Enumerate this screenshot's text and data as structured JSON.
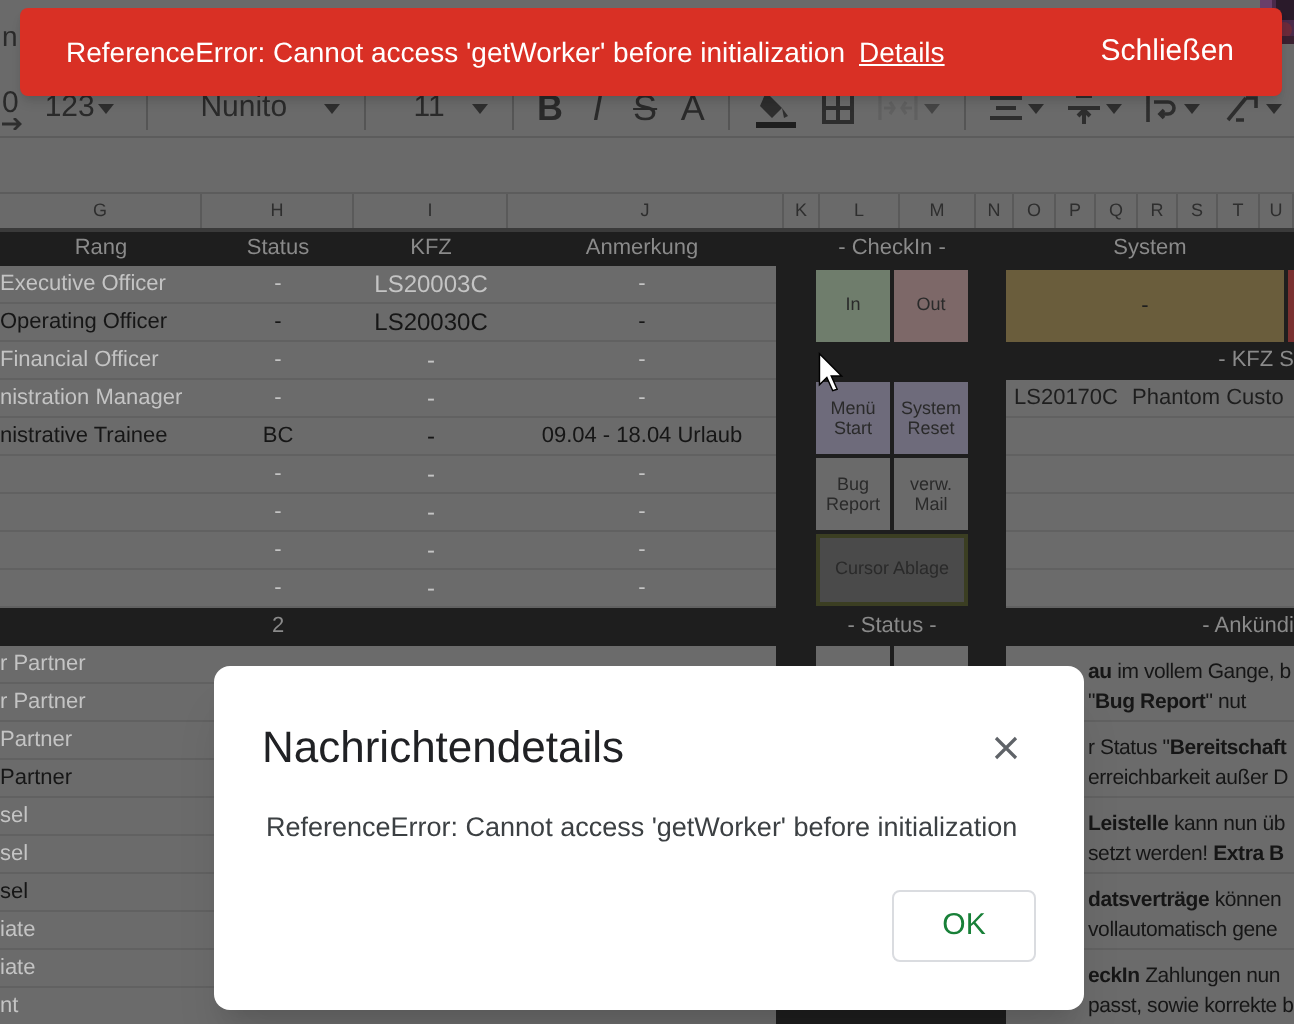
{
  "menu_fragment": "n",
  "toolbar": [
    {
      "kind": "decimal",
      "label": "0"
    },
    {
      "kind": "dropdown",
      "label": "123"
    },
    {
      "kind": "divider"
    },
    {
      "kind": "font_select",
      "label": "Nunito"
    },
    {
      "kind": "divider"
    },
    {
      "kind": "size_select",
      "label": "11"
    },
    {
      "kind": "divider"
    },
    {
      "kind": "bold",
      "label": "B"
    },
    {
      "kind": "italic",
      "label": "I"
    },
    {
      "kind": "strike",
      "label": "S"
    },
    {
      "kind": "text_color",
      "label": "A"
    },
    {
      "kind": "divider"
    },
    {
      "kind": "fill",
      "disabled": false
    },
    {
      "kind": "borders",
      "disabled": false
    },
    {
      "kind": "merge",
      "disabled": true
    },
    {
      "kind": "divider"
    },
    {
      "kind": "align",
      "disabled": false
    },
    {
      "kind": "valign",
      "disabled": false
    },
    {
      "kind": "wrap",
      "disabled": false
    },
    {
      "kind": "rotate",
      "disabled": false
    }
  ],
  "column_headers": [
    "G",
    "H",
    "I",
    "J",
    "K",
    "L",
    "M",
    "N",
    "O",
    "P",
    "Q",
    "R",
    "S",
    "T",
    "U"
  ],
  "table": {
    "columns": [
      "Rang",
      "Status",
      "KFZ",
      "Anmerkung"
    ],
    "rows": [
      {
        "rang": "Executive Officer",
        "status": "-",
        "kfz": "LS20003C",
        "note": "-",
        "active": false
      },
      {
        "rang": "Operating Officer",
        "status": "-",
        "kfz": "LS20030C",
        "note": "-",
        "active": true
      },
      {
        "rang": "Financial Officer",
        "status": "-",
        "kfz": "-",
        "note": "-",
        "active": false
      },
      {
        "rang": "nistration Manager",
        "status": "-",
        "kfz": "-",
        "note": "-",
        "active": false
      },
      {
        "rang": "nistrative Trainee",
        "status": "BC",
        "kfz": "-",
        "note": "09.04 - 18.04 Urlaub",
        "active": true
      },
      {
        "status": "-",
        "kfz": "-",
        "note": "-",
        "active": false
      },
      {
        "status": "-",
        "kfz": "-",
        "note": "-",
        "active": false
      },
      {
        "status": "-",
        "kfz": "-",
        "note": "-",
        "active": false
      },
      {
        "status": "-",
        "kfz": "-",
        "note": "-",
        "active": false
      }
    ]
  },
  "checkin": {
    "title": "- CheckIn -",
    "buttons": [
      {
        "label": "In",
        "color": "#6f7d6c"
      },
      {
        "label": "Out",
        "color": "#7d6868"
      }
    ],
    "actions": [
      {
        "label": "Menü Start",
        "color": "#6e6b7b"
      },
      {
        "label": "System Reset",
        "color": "#6e6b7b"
      },
      {
        "label": "Bug Report",
        "color": "#6a6a6a"
      },
      {
        "label": "verw. Mail",
        "color": "#6a6a6a"
      }
    ],
    "wide_action": {
      "label": "Cursor Ablage"
    }
  },
  "system": {
    "title": "System",
    "value": "-",
    "kfz_title": "- KFZ S",
    "kfz_rows": [
      {
        "plate": "LS20170C",
        "model": "Phantom Custo"
      },
      {},
      {},
      {},
      {},
      {}
    ]
  },
  "section_row": {
    "label": "2",
    "status_title": "- Status -",
    "announce_title": "- Ankündi"
  },
  "lower_rows": [
    {
      "text": "r Partner",
      "active": false
    },
    {
      "text": "r Partner",
      "active": false
    },
    {
      "text": "Partner",
      "active": false
    },
    {
      "text": "Partner",
      "active": true
    },
    {
      "text": "sel",
      "active": false
    },
    {
      "text": "sel",
      "active": false
    },
    {
      "text": "sel",
      "active": true
    },
    {
      "text": "iate",
      "active": false
    },
    {
      "text": "iate",
      "active": false
    },
    {
      "text": "nt",
      "active": false
    }
  ],
  "announcements": [
    [
      "**au** im vollem Gange, b",
      "\"**Bug Report**\" nut"
    ],
    [
      "r Status \"**Bereitschaft**",
      "erreichbarkeit außer D"
    ],
    [
      "**Leistelle** kann nun üb",
      "setzt werden! **Extra B**"
    ],
    [
      "**datsverträge** können",
      "vollautomatisch gene"
    ],
    [
      "**eckIn** Zahlungen nun",
      "passt, sowie korrekte b"
    ]
  ],
  "snackbar": {
    "message": "ReferenceError: Cannot access 'getWorker' before initialization",
    "link": "Details",
    "action": "Schließen"
  },
  "dialog": {
    "title": "Nachrichtendetails",
    "message": "ReferenceError: Cannot access 'getWorker' before initialization",
    "button": "OK"
  }
}
